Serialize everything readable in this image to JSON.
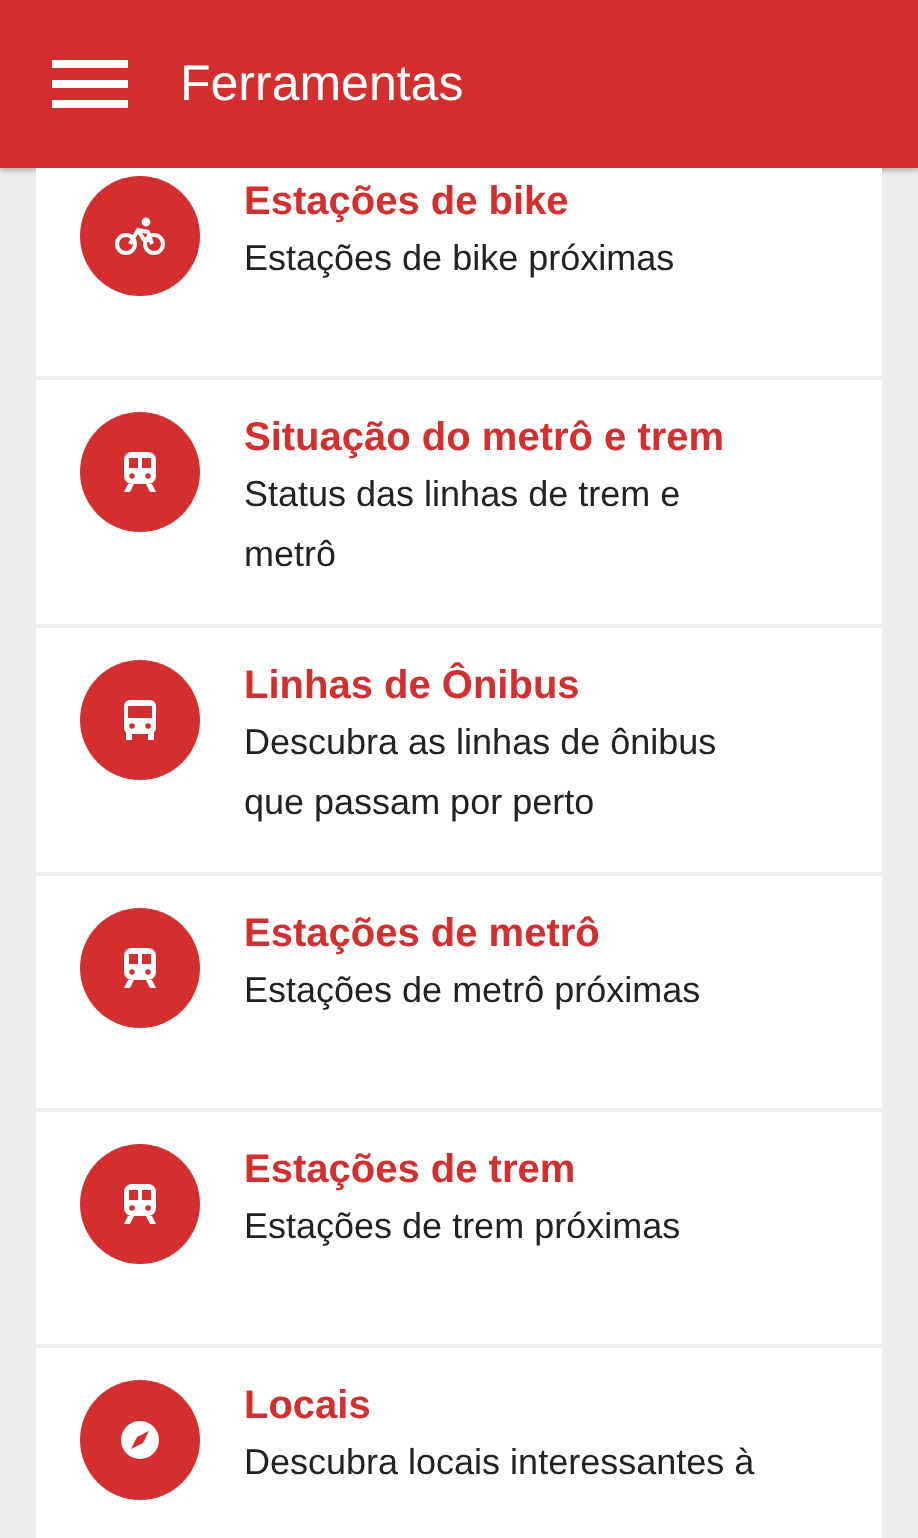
{
  "app_bar": {
    "title": "Ferramentas"
  },
  "tools": [
    {
      "kind": "bike",
      "title": "Estações de bike",
      "description": [
        "Estações de bike próximas"
      ]
    },
    {
      "kind": "train",
      "title": "Situação do metrô e trem",
      "description": [
        "Status das linhas de trem e",
        "metrô"
      ]
    },
    {
      "kind": "bus",
      "title": "Linhas de Ônibus",
      "description": [
        "Descubra as linhas de ônibus",
        "que passam por perto"
      ]
    },
    {
      "kind": "train",
      "title": "Estações de metrô",
      "description": [
        "Estações de metrô próximas"
      ]
    },
    {
      "kind": "train",
      "title": "Estações de trem",
      "description": [
        "Estações de trem próximas"
      ]
    },
    {
      "kind": "compass",
      "title": "Locais",
      "description": [
        "Descubra locais interessantes à"
      ]
    }
  ]
}
